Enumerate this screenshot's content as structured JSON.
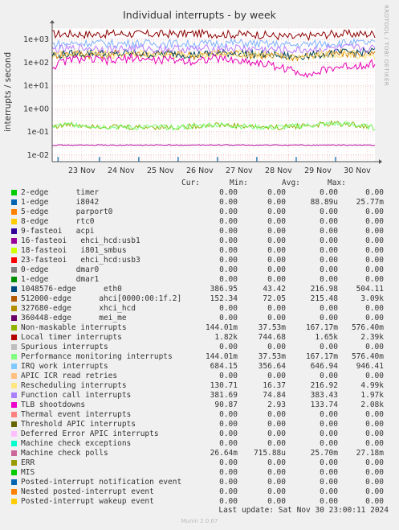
{
  "title": "Individual interrupts - by week",
  "side_label": "RRDTOOL / TOBI OETIKER",
  "chart_data": {
    "type": "line",
    "title": "Individual interrupts - by week",
    "ylabel": "interrupts / second",
    "yscale": "log",
    "ylim": [
      0.005,
      3000
    ],
    "y_ticks": [
      {
        "value": 0.01,
        "label": "1e-02"
      },
      {
        "value": 0.1,
        "label": "1e-01"
      },
      {
        "value": 1,
        "label": "1e+00"
      },
      {
        "value": 10,
        "label": "1e+01"
      },
      {
        "value": 100,
        "label": "1e+02"
      },
      {
        "value": 1000,
        "label": "1e+03"
      }
    ],
    "x_ticks": [
      "23 Nov",
      "24 Nov",
      "25 Nov",
      "26 Nov",
      "27 Nov",
      "28 Nov",
      "29 Nov",
      "30 Nov"
    ],
    "x_range_days": [
      0,
      8.2
    ],
    "grid": true,
    "series": [
      {
        "name": "Local timer interrupts",
        "color": "#8C0000",
        "values": [
          1650,
          1700,
          1600,
          1750,
          1700,
          1650,
          1700,
          1750,
          1700,
          1600,
          1650,
          1400,
          1200,
          1450,
          1700,
          1650,
          1700
        ]
      },
      {
        "name": "512000-edge ahci[0000:00:1f.2]",
        "color": "#CC7A00",
        "values": [
          200,
          250,
          210,
          230,
          260,
          220,
          240,
          200,
          230,
          250,
          210,
          190,
          170,
          200,
          230,
          240,
          210
        ]
      },
      {
        "name": "1048576-edge eth0",
        "color": "#00455E",
        "values": [
          200,
          230,
          260,
          210,
          250,
          220,
          240,
          210,
          230,
          260,
          220,
          200,
          180,
          210,
          250,
          260,
          300
        ]
      },
      {
        "name": "IRQ work interrupts",
        "color": "#7DB3FF",
        "values": [
          600,
          650,
          700,
          620,
          680,
          640,
          660,
          610,
          650,
          700,
          640,
          600,
          550,
          620,
          680,
          690,
          684
        ]
      },
      {
        "name": "Function call interrupts",
        "color": "#B87DFF",
        "values": [
          350,
          380,
          420,
          360,
          400,
          370,
          390,
          360,
          380,
          410,
          370,
          340,
          320,
          360,
          400,
          410,
          382
        ]
      },
      {
        "name": "Rescheduling interrupts",
        "color": "#FFE37D",
        "values": [
          200,
          230,
          260,
          210,
          240,
          220,
          230,
          200,
          220,
          240,
          210,
          190,
          170,
          200,
          230,
          240,
          131
        ]
      },
      {
        "name": "TLB shootdowns",
        "color": "#E600B4",
        "values": [
          60,
          140,
          130,
          110,
          160,
          120,
          130,
          110,
          150,
          120,
          100,
          70,
          40,
          30,
          60,
          70,
          91
        ]
      },
      {
        "name": "Non-maskable interrupts",
        "color": "#8DB300",
        "values": [
          0.17,
          0.2,
          0.18,
          0.16,
          0.15,
          0.16,
          0.15,
          0.17,
          0.2,
          0.18,
          0.16,
          0.15,
          0.17,
          0.19,
          0.22,
          0.2,
          0.14
        ]
      },
      {
        "name": "Performance monitoring interrupts",
        "color": "#7DFF7D",
        "values": [
          0.17,
          0.2,
          0.18,
          0.16,
          0.15,
          0.16,
          0.15,
          0.17,
          0.2,
          0.18,
          0.16,
          0.15,
          0.17,
          0.19,
          0.22,
          0.2,
          0.14
        ]
      },
      {
        "name": "Machine check polls",
        "color": "#B30C9A",
        "values": [
          0.026,
          0.026,
          0.026,
          0.026,
          0.026,
          0.026,
          0.026,
          0.026,
          0.026,
          0.026,
          0.026,
          0.026,
          0.026,
          0.026,
          0.026,
          0.026,
          0.026
        ]
      }
    ],
    "spikes": {
      "color": "#2C7FB8",
      "value": 0.008,
      "days": [
        0.15,
        1.2,
        2.2,
        3.2,
        4.2,
        5.2,
        6.2,
        7.2
      ]
    }
  },
  "legend_headers": {
    "cur": "Cur:",
    "min": "Min:",
    "avg": "Avg:",
    "max": "Max:"
  },
  "legend": [
    {
      "color": "#00CC00",
      "label": "2-edge      timer",
      "cur": "0.00",
      "min": "0.00",
      "avg": "0.00",
      "max": "0.00"
    },
    {
      "color": "#0066B3",
      "label": "1-edge      i8042",
      "cur": "0.00",
      "min": "0.00",
      "avg": "88.89u",
      "max": "25.77m"
    },
    {
      "color": "#FF8000",
      "label": "5-edge      parport0",
      "cur": "0.00",
      "min": "0.00",
      "avg": "0.00",
      "max": "0.00"
    },
    {
      "color": "#FFCC00",
      "label": "8-edge      rtc0",
      "cur": "0.00",
      "min": "0.00",
      "avg": "0.00",
      "max": "0.00"
    },
    {
      "color": "#330099",
      "label": "9-fasteoi   acpi",
      "cur": "0.00",
      "min": "0.00",
      "avg": "0.00",
      "max": "0.00"
    },
    {
      "color": "#990099",
      "label": "16-fasteoi   ehci_hcd:usb1",
      "cur": "0.00",
      "min": "0.00",
      "avg": "0.00",
      "max": "0.00"
    },
    {
      "color": "#CCFF00",
      "label": "18-fasteoi   i801_smbus",
      "cur": "0.00",
      "min": "0.00",
      "avg": "0.00",
      "max": "0.00"
    },
    {
      "color": "#FF0000",
      "label": "23-fasteoi   ehci_hcd:usb3",
      "cur": "0.00",
      "min": "0.00",
      "avg": "0.00",
      "max": "0.00"
    },
    {
      "color": "#808080",
      "label": "0-edge      dmar0",
      "cur": "0.00",
      "min": "0.00",
      "avg": "0.00",
      "max": "0.00"
    },
    {
      "color": "#008F00",
      "label": "1-edge      dmar1",
      "cur": "0.00",
      "min": "0.00",
      "avg": "0.00",
      "max": "0.00"
    },
    {
      "color": "#00487D",
      "label": "1048576-edge      eth0",
      "cur": "386.95",
      "min": "43.42",
      "avg": "216.98",
      "max": "504.11"
    },
    {
      "color": "#B35A00",
      "label": "512000-edge      ahci[0000:00:1f.2]",
      "cur": "152.34",
      "min": "72.05",
      "avg": "215.48",
      "max": "3.09k"
    },
    {
      "color": "#B38F00",
      "label": "327680-edge      xhci_hcd",
      "cur": "0.00",
      "min": "0.00",
      "avg": "0.00",
      "max": "0.00"
    },
    {
      "color": "#6B006B",
      "label": "360448-edge      mei_me",
      "cur": "0.00",
      "min": "0.00",
      "avg": "0.00",
      "max": "0.00"
    },
    {
      "color": "#8FB300",
      "label": "Non-maskable interrupts",
      "cur": "144.01m",
      "min": "37.53m",
      "avg": "167.17m",
      "max": "576.40m"
    },
    {
      "color": "#B30000",
      "label": "Local timer interrupts",
      "cur": "1.82k",
      "min": "744.68",
      "avg": "1.65k",
      "max": "2.39k"
    },
    {
      "color": "#BEBEBE",
      "label": "Spurious interrupts",
      "cur": "0.00",
      "min": "0.00",
      "avg": "0.00",
      "max": "0.00"
    },
    {
      "color": "#80FF80",
      "label": "Performance monitoring interrupts",
      "cur": "144.01m",
      "min": "37.53m",
      "avg": "167.17m",
      "max": "576.40m"
    },
    {
      "color": "#80C9FF",
      "label": "IRQ work interrupts",
      "cur": "684.15",
      "min": "356.64",
      "avg": "646.94",
      "max": "946.41"
    },
    {
      "color": "#FFC080",
      "label": "APIC ICR read retries",
      "cur": "0.00",
      "min": "0.00",
      "avg": "0.00",
      "max": "0.00"
    },
    {
      "color": "#FFE680",
      "label": "Rescheduling interrupts",
      "cur": "130.71",
      "min": "16.37",
      "avg": "216.92",
      "max": "4.99k"
    },
    {
      "color": "#AA80FF",
      "label": "Function call interrupts",
      "cur": "381.69",
      "min": "74.84",
      "avg": "383.43",
      "max": "1.97k"
    },
    {
      "color": "#EE00CC",
      "label": "TLB shootdowns",
      "cur": "90.87",
      "min": "2.93",
      "avg": "133.74",
      "max": "2.08k"
    },
    {
      "color": "#FF8080",
      "label": "Thermal event interrupts",
      "cur": "0.00",
      "min": "0.00",
      "avg": "0.00",
      "max": "0.00"
    },
    {
      "color": "#666600",
      "label": "Threshold APIC interrupts",
      "cur": "0.00",
      "min": "0.00",
      "avg": "0.00",
      "max": "0.00"
    },
    {
      "color": "#FFBFFF",
      "label": "Deferred Error APIC interrupts",
      "cur": "0.00",
      "min": "0.00",
      "avg": "0.00",
      "max": "0.00"
    },
    {
      "color": "#00FFCC",
      "label": "Machine check exceptions",
      "cur": "0.00",
      "min": "0.00",
      "avg": "0.00",
      "max": "0.00"
    },
    {
      "color": "#CC6699",
      "label": "Machine check polls",
      "cur": "26.64m",
      "min": "715.88u",
      "avg": "25.70m",
      "max": "27.18m"
    },
    {
      "color": "#999900",
      "label": "ERR",
      "cur": "0.00",
      "min": "0.00",
      "avg": "0.00",
      "max": "0.00"
    },
    {
      "color": "#00CC00",
      "label": "MIS",
      "cur": "0.00",
      "min": "0.00",
      "avg": "0.00",
      "max": "0.00"
    },
    {
      "color": "#0066B3",
      "label": "Posted-interrupt notification event",
      "cur": "0.00",
      "min": "0.00",
      "avg": "0.00",
      "max": "0.00"
    },
    {
      "color": "#FF8000",
      "label": "Nested posted-interrupt event",
      "cur": "0.00",
      "min": "0.00",
      "avg": "0.00",
      "max": "0.00"
    },
    {
      "color": "#FFCC00",
      "label": "Posted-interrupt wakeup event",
      "cur": "0.00",
      "min": "0.00",
      "avg": "0.00",
      "max": "0.00"
    }
  ],
  "footer": "Last update: Sat Nov 30 23:00:11 2024",
  "munin": "Munin 2.0.67"
}
